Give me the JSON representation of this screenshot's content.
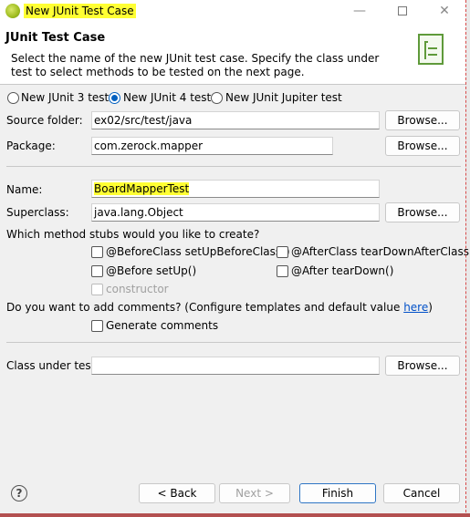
{
  "window": {
    "title": "New JUnit Test Case",
    "minimize": "—",
    "close": "✕"
  },
  "header": {
    "title": "JUnit Test Case",
    "message": "Select the name of the new JUnit test case. Specify the class under test to select methods to be tested on the next page."
  },
  "junit_version": {
    "options": [
      "New JUnit 3 test",
      "New JUnit 4 test",
      "New JUnit Jupiter test"
    ],
    "selected": "New JUnit 4 test"
  },
  "form": {
    "source_folder_label": "Source folder:",
    "source_folder_value": "ex02/src/test/java",
    "package_label": "Package:",
    "package_value": "com.zerock.mapper",
    "name_label": "Name:",
    "name_value": "BoardMapperTest",
    "superclass_label": "Superclass:",
    "superclass_value": "java.lang.Object",
    "browse_label": "Browse...",
    "stubs_question": "Which method stubs would you like to create?",
    "stub_before_class": "@BeforeClass setUpBeforeClass()",
    "stub_after_class": "@AfterClass tearDownAfterClass()",
    "stub_before": "@Before setUp()",
    "stub_after": "@After tearDown()",
    "stub_constructor": "constructor",
    "comments_question": "Do you want to add comments? (Configure templates and default value ",
    "comments_link": "here",
    "comments_close": ")",
    "generate_comments": "Generate comments",
    "class_under_test_label": "Class under test:",
    "class_under_test_value": ""
  },
  "footer": {
    "help": "?",
    "back": "< Back",
    "next": "Next >",
    "finish": "Finish",
    "cancel": "Cancel"
  },
  "colors": {
    "highlight": "#ffff33",
    "accent": "#0060c0",
    "link": "#0050c8"
  }
}
